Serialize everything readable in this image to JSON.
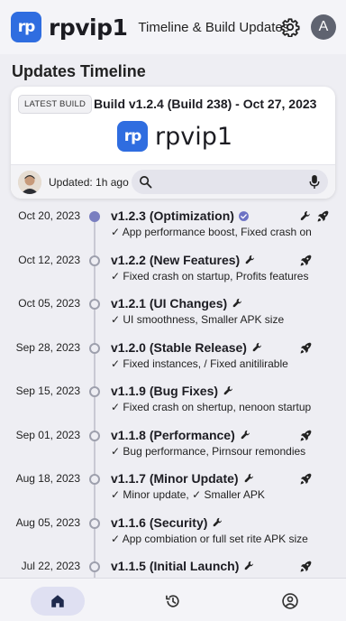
{
  "header": {
    "logo_text": "rp",
    "app_name": "rpvip1",
    "subtitle": "Timeline & Build Updates",
    "avatar_initial": "A",
    "icons": [
      "gear-icon",
      "avatar"
    ]
  },
  "section_title": "Updates Timeline",
  "latest_build": {
    "badge": "LATEST BUILD",
    "title": "Build v1.2.4 (Build 238) - Oct 27, 2023",
    "brand_logo_text": "rp",
    "brand_name": "rpvip1",
    "updated": "Updated: 1h ago"
  },
  "colors": {
    "brand": "#2f6de0",
    "active_dot": "#7a7fc0",
    "nav_active": "#dfe0f2"
  },
  "timeline": [
    {
      "date": "Oct 20, 2023",
      "title": "v1.2.3 (Optimization)",
      "desc": "✓ App performance boost, Fixed crash on",
      "active": true,
      "verified": true,
      "inline_wrench": false,
      "right_icons": [
        "wrench-icon",
        "rocket-icon"
      ]
    },
    {
      "date": "Oct 12, 2023",
      "title": "v1.2.2 (New Features)",
      "desc": "✓ Fixed crash on startup, Profits features",
      "active": false,
      "verified": false,
      "inline_wrench": true,
      "right_icons": [
        "rocket-icon"
      ]
    },
    {
      "date": "Oct 05, 2023",
      "title": "v1.2.1 (UI Changes)",
      "desc": "✓ UI smoothness,  Smaller APK size",
      "active": false,
      "verified": false,
      "inline_wrench": true,
      "right_icons": []
    },
    {
      "date": "Sep 28, 2023",
      "title": "v1.2.0 (Stable Release)",
      "desc": "✓ Fixed instances, / Fixed anitilirable",
      "active": false,
      "verified": false,
      "inline_wrench": true,
      "right_icons": [
        "rocket-icon"
      ]
    },
    {
      "date": "Sep 15, 2023",
      "title": "v1.1.9 (Bug Fixes)",
      "desc": "✓ Fixed crash on shertup, nenoon startup",
      "active": false,
      "verified": false,
      "inline_wrench": true,
      "right_icons": []
    },
    {
      "date": "Sep 01, 2023",
      "title": "v1.1.8 (Performance)",
      "desc": "✓ Bug performance, Pirnsour remondies",
      "active": false,
      "verified": false,
      "inline_wrench": true,
      "right_icons": [
        "rocket-icon"
      ]
    },
    {
      "date": "Aug 18, 2023",
      "title": "v1.1.7 (Minor Update)",
      "desc": "✓ Minor update, ✓ Smaller APK",
      "active": false,
      "verified": false,
      "inline_wrench": true,
      "right_icons": [
        "rocket-icon"
      ]
    },
    {
      "date": "Aug 05, 2023",
      "title": "v1.1.6 (Security)",
      "desc": "✓ App combiation or full set rite APK size",
      "active": false,
      "verified": false,
      "inline_wrench": true,
      "right_icons": []
    },
    {
      "date": "Jul 22, 2023",
      "title": "v1.1.5 (Initial Launch)",
      "desc": "",
      "active": false,
      "verified": false,
      "inline_wrench": true,
      "right_icons": [
        "rocket-icon"
      ]
    }
  ],
  "bottom_nav": [
    "home-icon",
    "history-icon",
    "profile-icon"
  ]
}
